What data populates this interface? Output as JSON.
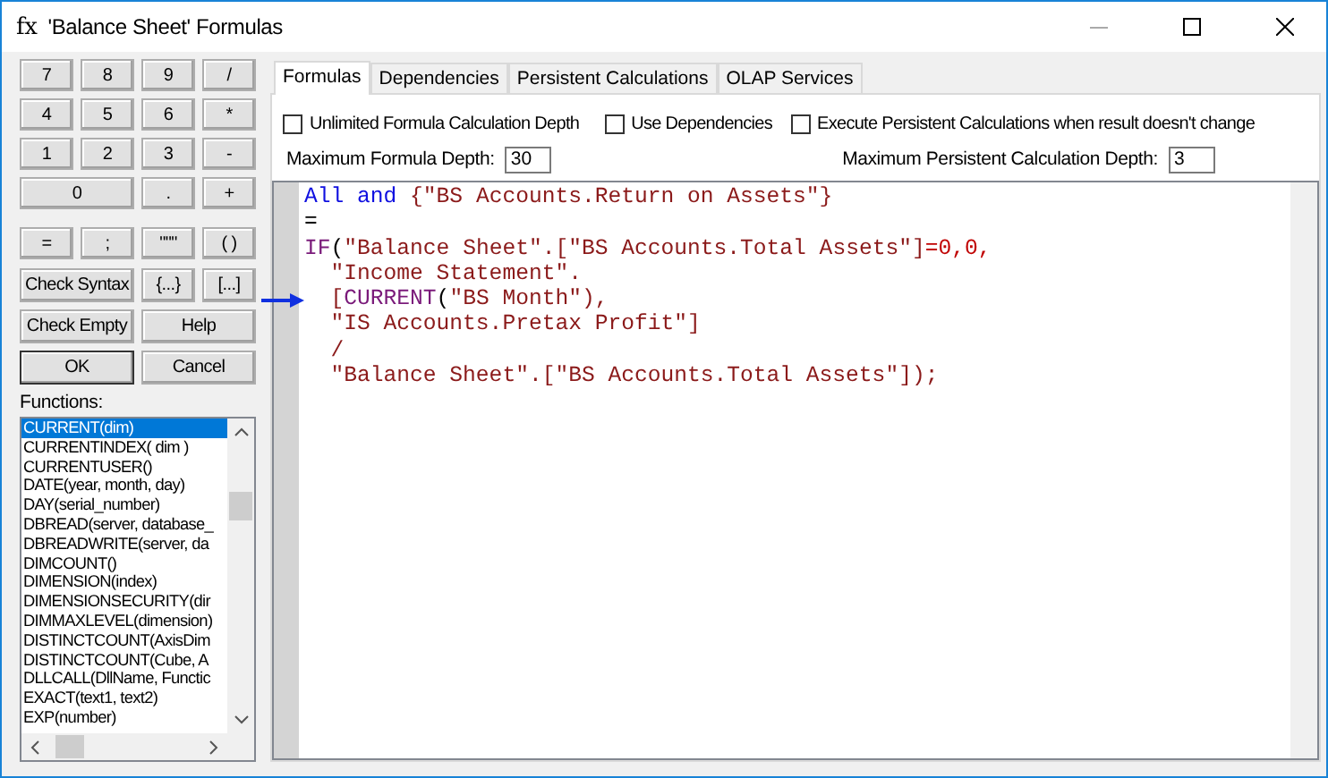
{
  "window": {
    "icon": "fx",
    "title": "'Balance Sheet' Formulas"
  },
  "keypad": [
    {
      "label": "7",
      "wide": false
    },
    {
      "label": "8",
      "wide": false
    },
    {
      "label": "9",
      "wide": false
    },
    {
      "label": "/",
      "wide": false
    },
    {
      "label": "4",
      "wide": false
    },
    {
      "label": "5",
      "wide": false
    },
    {
      "label": "6",
      "wide": false
    },
    {
      "label": "*",
      "wide": false
    },
    {
      "label": "1",
      "wide": false
    },
    {
      "label": "2",
      "wide": false
    },
    {
      "label": "3",
      "wide": false
    },
    {
      "label": "-",
      "wide": false
    },
    {
      "label": "0",
      "wide": true
    },
    {
      "label": ".",
      "wide": false
    },
    {
      "label": "+",
      "wide": false
    }
  ],
  "operators": [
    "=",
    ";",
    "\"\"\"",
    "( )"
  ],
  "actions": [
    {
      "label": "Check Syntax",
      "wide": true
    },
    {
      "label": "{...}",
      "wide": false
    },
    {
      "label": "[...]",
      "wide": false
    },
    {
      "label": "Check Empty",
      "wide": true
    },
    {
      "label": "Help",
      "wide": true
    },
    {
      "label": "OK",
      "wide": true
    },
    {
      "label": "Cancel",
      "wide": true
    }
  ],
  "functions_label": "Functions:",
  "functions": [
    {
      "label": "CURRENT(dim)",
      "selected": true
    },
    {
      "label": "CURRENTINDEX( dim )",
      "selected": false
    },
    {
      "label": "CURRENTUSER()",
      "selected": false
    },
    {
      "label": "DATE(year, month, day)",
      "selected": false
    },
    {
      "label": "DAY(serial_number)",
      "selected": false
    },
    {
      "label": "DBREAD(server, database_",
      "selected": false
    },
    {
      "label": "DBREADWRITE(server, da",
      "selected": false
    },
    {
      "label": "DIMCOUNT()",
      "selected": false
    },
    {
      "label": "DIMENSION(index)",
      "selected": false
    },
    {
      "label": "DIMENSIONSECURITY(dir",
      "selected": false
    },
    {
      "label": "DIMMAXLEVEL(dimension)",
      "selected": false
    },
    {
      "label": "DISTINCTCOUNT(AxisDim",
      "selected": false
    },
    {
      "label": "DISTINCTCOUNT(Cube, A",
      "selected": false
    },
    {
      "label": "DLLCALL(DllName, Functic",
      "selected": false
    },
    {
      "label": "EXACT(text1, text2)",
      "selected": false
    },
    {
      "label": "EXP(number)",
      "selected": false
    }
  ],
  "tabs": [
    {
      "label": "Formulas",
      "selected": true
    },
    {
      "label": "Dependencies",
      "selected": false
    },
    {
      "label": "Persistent Calculations",
      "selected": false
    },
    {
      "label": "OLAP Services",
      "selected": false
    }
  ],
  "options": [
    {
      "label": "Unlimited Formula Calculation Depth",
      "checked": false
    },
    {
      "label": "Use Dependencies",
      "checked": false
    },
    {
      "label": "Execute Persistent Calculations when result doesn't change",
      "checked": false
    }
  ],
  "max_formula_depth": {
    "label": "Maximum Formula Depth:",
    "value": "30"
  },
  "max_persistent_depth": {
    "label": "Maximum Persistent Calculation Depth:",
    "value": "3"
  },
  "code_lines": [
    {
      "arrow": false,
      "tokens": [
        {
          "kind": "keyword",
          "text": "All and "
        },
        {
          "kind": "string",
          "text": "{\"BS Accounts.Return on Assets\"}"
        }
      ]
    },
    {
      "arrow": false,
      "tokens": [
        {
          "kind": "plain",
          "text": "="
        }
      ]
    },
    {
      "arrow": false,
      "tokens": [
        {
          "kind": "function",
          "text": "IF"
        },
        {
          "kind": "plain",
          "text": "("
        },
        {
          "kind": "string",
          "text": "\"Balance Sheet\".[\"BS Accounts.Total Assets\"]"
        },
        {
          "kind": "number",
          "text": "=0,0,"
        }
      ]
    },
    {
      "arrow": false,
      "tokens": [
        {
          "kind": "string",
          "text": "  \"Income Statement\"."
        }
      ]
    },
    {
      "arrow": true,
      "tokens": [
        {
          "kind": "string",
          "text": "  ["
        },
        {
          "kind": "function",
          "text": "CURRENT"
        },
        {
          "kind": "plain",
          "text": "("
        },
        {
          "kind": "string",
          "text": "\"BS Month\"),"
        }
      ]
    },
    {
      "arrow": false,
      "tokens": [
        {
          "kind": "string",
          "text": "  \"IS Accounts.Pretax Profit\"]"
        }
      ]
    },
    {
      "arrow": false,
      "tokens": [
        {
          "kind": "string",
          "text": "  /"
        }
      ]
    },
    {
      "arrow": false,
      "tokens": [
        {
          "kind": "string",
          "text": "  \"Balance Sheet\".[\"BS Accounts.Total Assets\"]);"
        }
      ]
    }
  ]
}
